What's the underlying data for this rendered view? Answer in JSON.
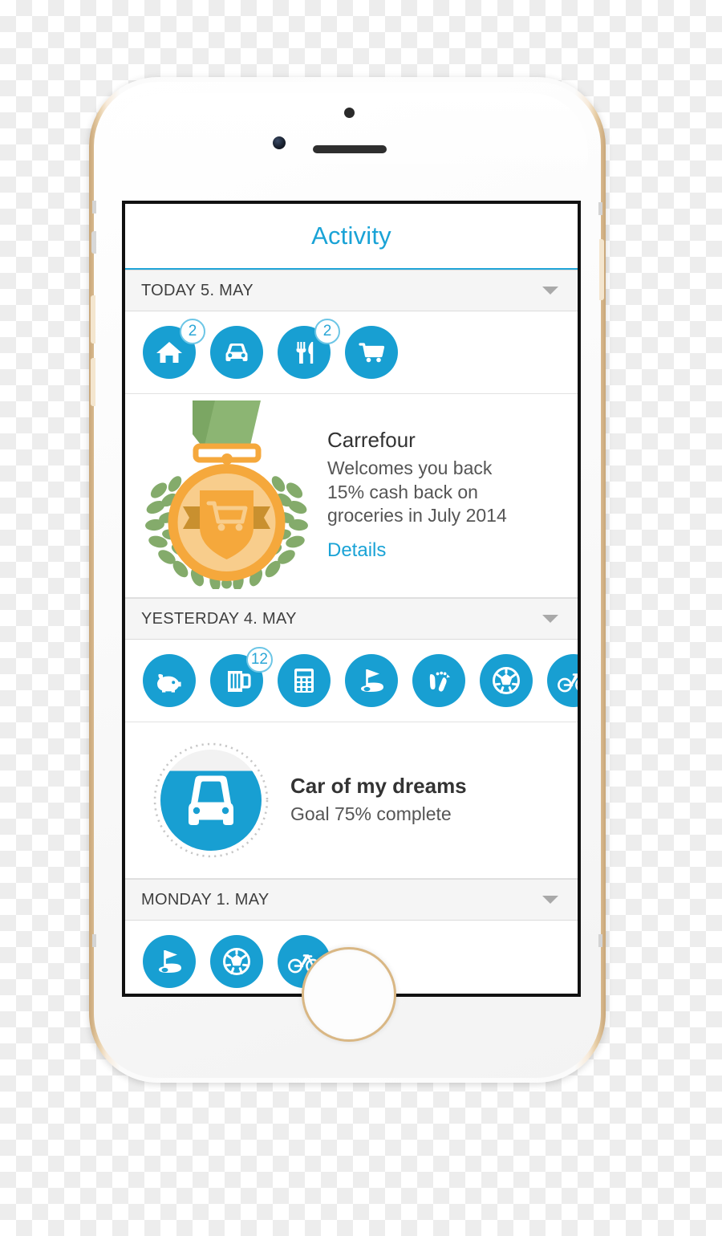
{
  "app": {
    "nav_title": "Activity",
    "accent_color": "#1aa3d6",
    "icon_bg_color": "#189fd2"
  },
  "sections": [
    {
      "header": "TODAY 5. MAY",
      "chevron": "chevron-down-icon",
      "icons": [
        {
          "name": "home-icon",
          "badge": "2"
        },
        {
          "name": "car-icon",
          "badge": ""
        },
        {
          "name": "restaurant-icon",
          "badge": "2"
        },
        {
          "name": "shopping-cart-icon",
          "badge": ""
        }
      ]
    },
    {
      "header": "YESTERDAY 4. MAY",
      "chevron": "chevron-down-icon",
      "icons": [
        {
          "name": "piggy-bank-icon",
          "badge": ""
        },
        {
          "name": "beer-mug-icon",
          "badge": "12"
        },
        {
          "name": "calculator-icon",
          "badge": ""
        },
        {
          "name": "golf-icon",
          "badge": ""
        },
        {
          "name": "footsteps-icon",
          "badge": ""
        },
        {
          "name": "soccer-ball-icon",
          "badge": ""
        },
        {
          "name": "bicycle-icon",
          "badge": ""
        }
      ]
    },
    {
      "header": "MONDAY 1. MAY",
      "chevron": "chevron-down-icon",
      "icons": [
        {
          "name": "golf-icon",
          "badge": ""
        },
        {
          "name": "soccer-ball-icon",
          "badge": ""
        },
        {
          "name": "bicycle-icon",
          "badge": ""
        }
      ]
    }
  ],
  "offer_card": {
    "media": "medal-award-icon",
    "title": "Carrefour",
    "line1": "Welcomes you back",
    "line2": "15% cash back on",
    "line3": "groceries in July 2014",
    "link": "Details",
    "colors": {
      "ribbon": "#7fa968",
      "medal_outer": "#f5a83c",
      "medal_inner": "#f8cd8c",
      "laurel": "#84ab6b"
    }
  },
  "goal_card": {
    "media": "car-goal-icon",
    "title": "Car of my dreams",
    "subtitle": "Goal 75% complete",
    "progress_percent": 75
  }
}
